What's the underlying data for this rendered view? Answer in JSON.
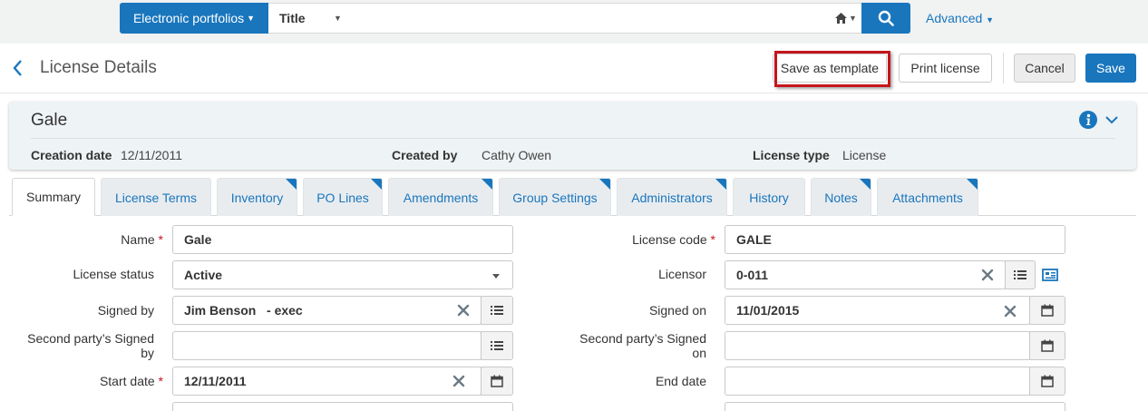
{
  "search": {
    "scope_label": "Electronic portfolios",
    "field_label": "Title",
    "query": "",
    "advanced_label": "Advanced"
  },
  "header": {
    "title": "License Details",
    "save_template_label": "Save as template",
    "print_label": "Print license",
    "cancel_label": "Cancel",
    "save_label": "Save"
  },
  "record": {
    "name": "Gale",
    "creation_date_label": "Creation date",
    "creation_date": "12/11/2011",
    "created_by_label": "Created by",
    "created_by": "Cathy Owen",
    "license_type_label": "License type",
    "license_type": "License"
  },
  "tabs": [
    {
      "label": "Summary"
    },
    {
      "label": "License Terms"
    },
    {
      "label": "Inventory"
    },
    {
      "label": "PO Lines"
    },
    {
      "label": "Amendments"
    },
    {
      "label": "Group Settings"
    },
    {
      "label": "Administrators"
    },
    {
      "label": "History"
    },
    {
      "label": "Notes"
    },
    {
      "label": "Attachments"
    }
  ],
  "form": {
    "name_label": "Name",
    "name_value": "Gale",
    "license_code_label": "License code",
    "license_code_value": "GALE",
    "license_status_label": "License status",
    "license_status_value": "Active",
    "licensor_label": "Licensor",
    "licensor_value": "0-011",
    "signed_by_label": "Signed by",
    "signed_by_value": "Jim Benson   - exec",
    "signed_on_label": "Signed on",
    "signed_on_value": "11/01/2015",
    "second_party_signed_by_label_1": "Second party’s Signed",
    "second_party_signed_by_label_2": "by",
    "second_party_signed_by_value": "",
    "second_party_signed_on_label_1": "Second party’s Signed",
    "second_party_signed_on_label_2": "on",
    "second_party_signed_on_value": "",
    "start_date_label": "Start date",
    "start_date_value": "12/11/2011",
    "end_date_label": "End date",
    "end_date_value": "",
    "required_mark": "*"
  },
  "colors": {
    "primary": "#1976bd",
    "highlight": "#c4161c",
    "required": "#c4161c"
  }
}
